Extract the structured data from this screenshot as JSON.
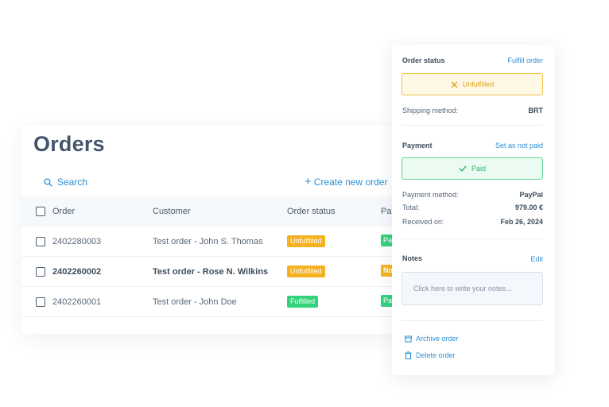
{
  "orders": {
    "title": "Orders",
    "search_label": "Search",
    "create_plus": "+",
    "create_label": "Create new order",
    "columns": [
      "Order",
      "Customer",
      "Order status",
      "Pa"
    ],
    "rows": [
      {
        "order": "2402280003",
        "customer": "Test order - John S. Thomas",
        "status": "Unfulfilled",
        "payment": "Pa"
      },
      {
        "order": "2402260002",
        "customer": "Test order - Rose N. Wilkins",
        "status": "Unfulfilled",
        "payment": "No"
      },
      {
        "order": "2402260001",
        "customer": "Test order - John Doe",
        "status": "Fulfilled",
        "payment": "Pa"
      }
    ]
  },
  "panel": {
    "order_status_label": "Order status",
    "fulfill_link": "Fulfill order",
    "status_value": "Unfulfilled",
    "shipping_method_label": "Shipping method:",
    "shipping_method_value": "BRT",
    "payment_label": "Payment",
    "set_not_paid_link": "Set as not paid",
    "payment_value": "Paid",
    "payment_method_label": "Payment method:",
    "payment_method_value": "PayPal",
    "total_label": "Total:",
    "total_value": "979.00 €",
    "received_label": "Received on:",
    "received_value": "Feb 26, 2024",
    "notes_label": "Notes",
    "edit_link": "Edit",
    "notes_placeholder": "Click here to write your notes...",
    "archive_label": "Archive order",
    "delete_label": "Delete order"
  },
  "colors": {
    "accent": "#2a8fd6",
    "unfulfilled": "#f4b223",
    "fulfilled": "#35d27c",
    "heading": "#44566c"
  }
}
